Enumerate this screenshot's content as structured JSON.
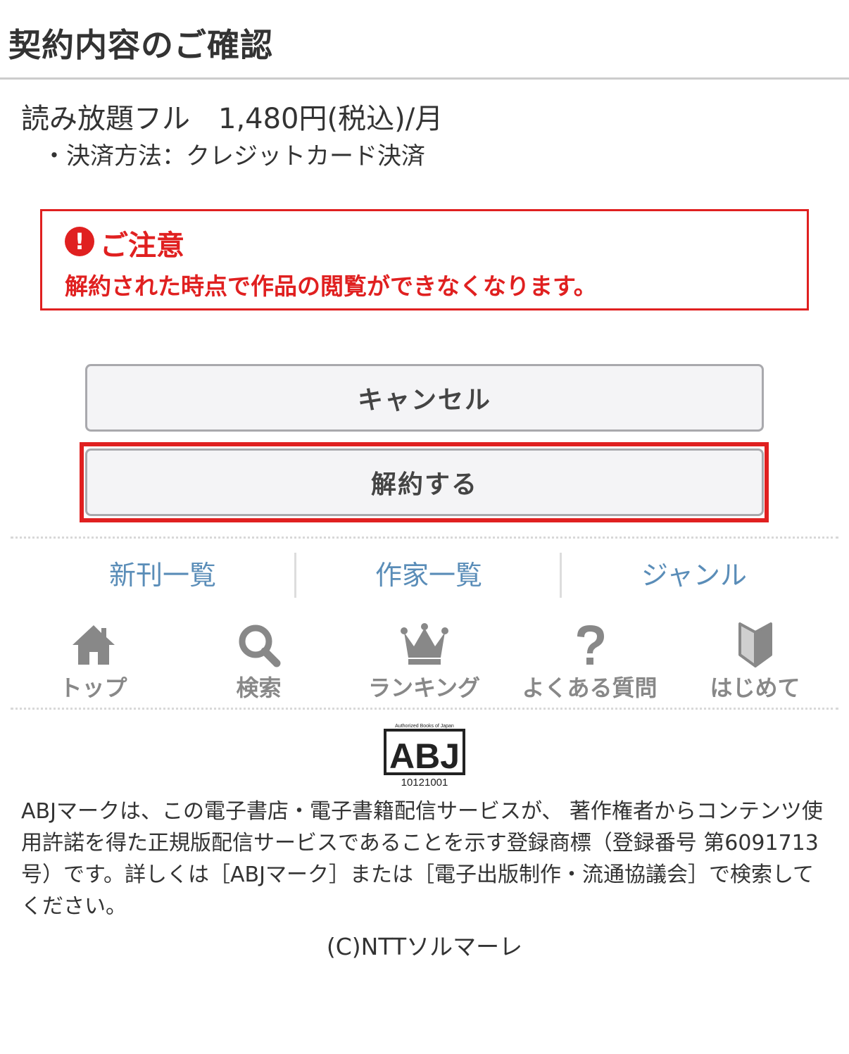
{
  "header": {
    "title": "契約内容のご確認"
  },
  "plan": {
    "line": "読み放題フル　1,480円(税込)/月",
    "payment": "・決済方法：クレジットカード決済"
  },
  "notice": {
    "icon_glyph": "!",
    "title": "ご注意",
    "text": "解約された時点で作品の閲覧ができなくなります。",
    "color": "#e02020"
  },
  "buttons": {
    "cancel": "キャンセル",
    "cancel_contract": "解約する"
  },
  "links": [
    {
      "label": "新刊一覧"
    },
    {
      "label": "作家一覧"
    },
    {
      "label": "ジャンル"
    }
  ],
  "nav": [
    {
      "label": "トップ",
      "icon": "home-icon"
    },
    {
      "label": "検索",
      "icon": "search-icon"
    },
    {
      "label": "ランキング",
      "icon": "crown-icon"
    },
    {
      "label": "よくある質問",
      "icon": "question-icon"
    },
    {
      "label": "はじめて",
      "icon": "beginner-mark-icon"
    }
  ],
  "abj": {
    "logo_caption": "Authorized Books of Japan",
    "logo_mark": "ABJ",
    "logo_number": "10121001",
    "description": "ABJマークは、この電子書店・電子書籍配信サービスが、 著作権者からコンテンツ使用許諾を得た正規版配信サービスであることを示す登録商標（登録番号 第6091713号）です。詳しくは［ABJマーク］または［電子出版制作・流通協議会］で検索してください。"
  },
  "footer": {
    "copyright": "(C)NTTソルマーレ"
  }
}
